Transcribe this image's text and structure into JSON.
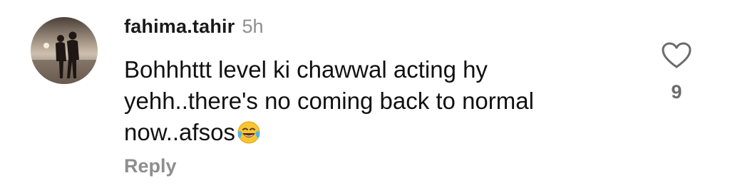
{
  "comment": {
    "username": "fahima.tahir",
    "time_ago": "5h",
    "text": "Bohhhttt level ki chawwal acting hy yehh..there's no coming back to normal now..afsos",
    "emoji": "face-with-tears-of-joy",
    "like_count": "9",
    "reply_label": "Reply",
    "like_icon": "heart-outline-icon"
  },
  "colors": {
    "username": "#1a1a1a",
    "meta_gray": "#8e8e8e",
    "like_count": "#6b6b6b",
    "text": "#111111"
  }
}
